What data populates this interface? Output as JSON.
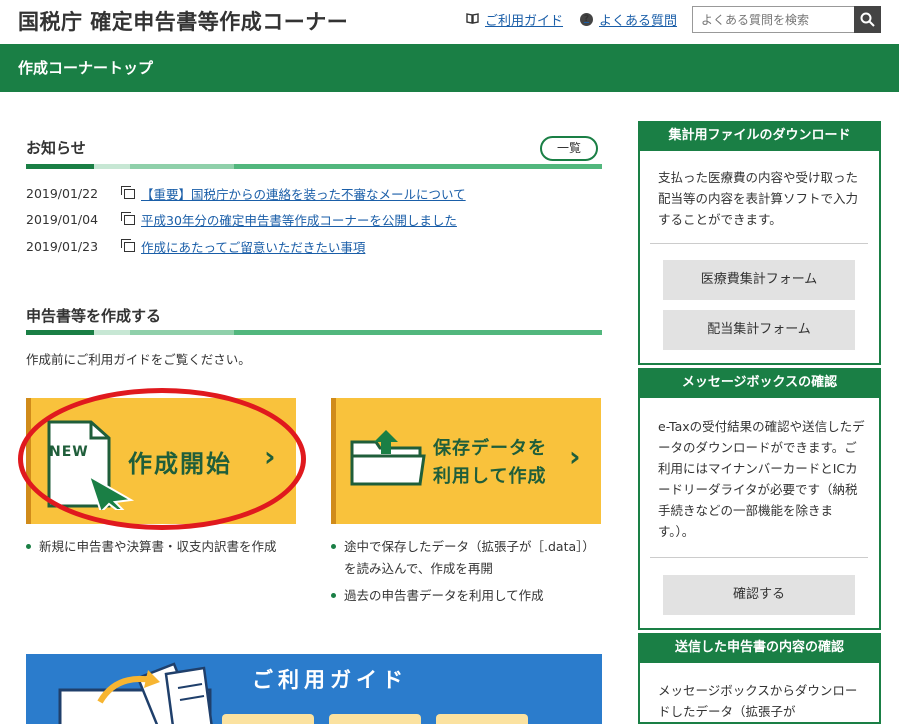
{
  "header": {
    "title": "国税庁 確定申告書等作成コーナー",
    "guide_link": "ご利用ガイド",
    "faq_link": "よくある質問",
    "search_placeholder": "よくある質問を検索"
  },
  "topbar": {
    "label": "作成コーナートップ"
  },
  "news": {
    "title": "お知らせ",
    "list_button": "一覧",
    "items": [
      {
        "date": "2019/01/22",
        "text": "【重要】国税庁からの連絡を装った不審なメールについて"
      },
      {
        "date": "2019/01/04",
        "text": "平成30年分の確定申告書等作成コーナーを公開しました"
      },
      {
        "date": "2019/01/23",
        "text": "作成にあたってご留意いただきたい事項"
      }
    ]
  },
  "create": {
    "title": "申告書等を作成する",
    "intro": "作成前にご利用ガイドをご覧ください。",
    "new_badge": "NEW",
    "new_label": "作成開始",
    "save_label_1": "保存データを",
    "save_label_2": "利用して作成",
    "new_bullets": [
      "新規に申告書や決算書・収支内訳書を作成"
    ],
    "save_bullet_1a": "途中で保存したデータ（拡張子が［.data］）",
    "save_bullet_1b": "を読み込んで、作成を再開",
    "save_bullet_2": "過去の申告書データを利用して作成"
  },
  "guide_banner": {
    "title": "ご利用ガイド"
  },
  "sidebar": {
    "download": {
      "title": "集計用ファイルのダウンロード",
      "text": "支払った医療費の内容や受け取った配当等の内容を表計算ソフトで入力することができます。",
      "btn1": "医療費集計フォーム",
      "btn2": "配当集計フォーム"
    },
    "messagebox": {
      "title": "メッセージボックスの確認",
      "text": "e-Taxの受付結果の確認や送信したデータのダウンロードができます。ご利用にはマイナンバーカードとICカードリーダライタが必要です（納税手続きなどの一部機能を除きます。）。",
      "btn": "確認する"
    },
    "sent": {
      "title": "送信した申告書の内容の確認",
      "text": "メッセージボックスからダウンロードしたデータ（拡張子が"
    }
  },
  "colors": {
    "green": "#1a7f45",
    "yellow": "#f9c23c",
    "red": "#e0191e",
    "blue": "#2b7ccc"
  }
}
